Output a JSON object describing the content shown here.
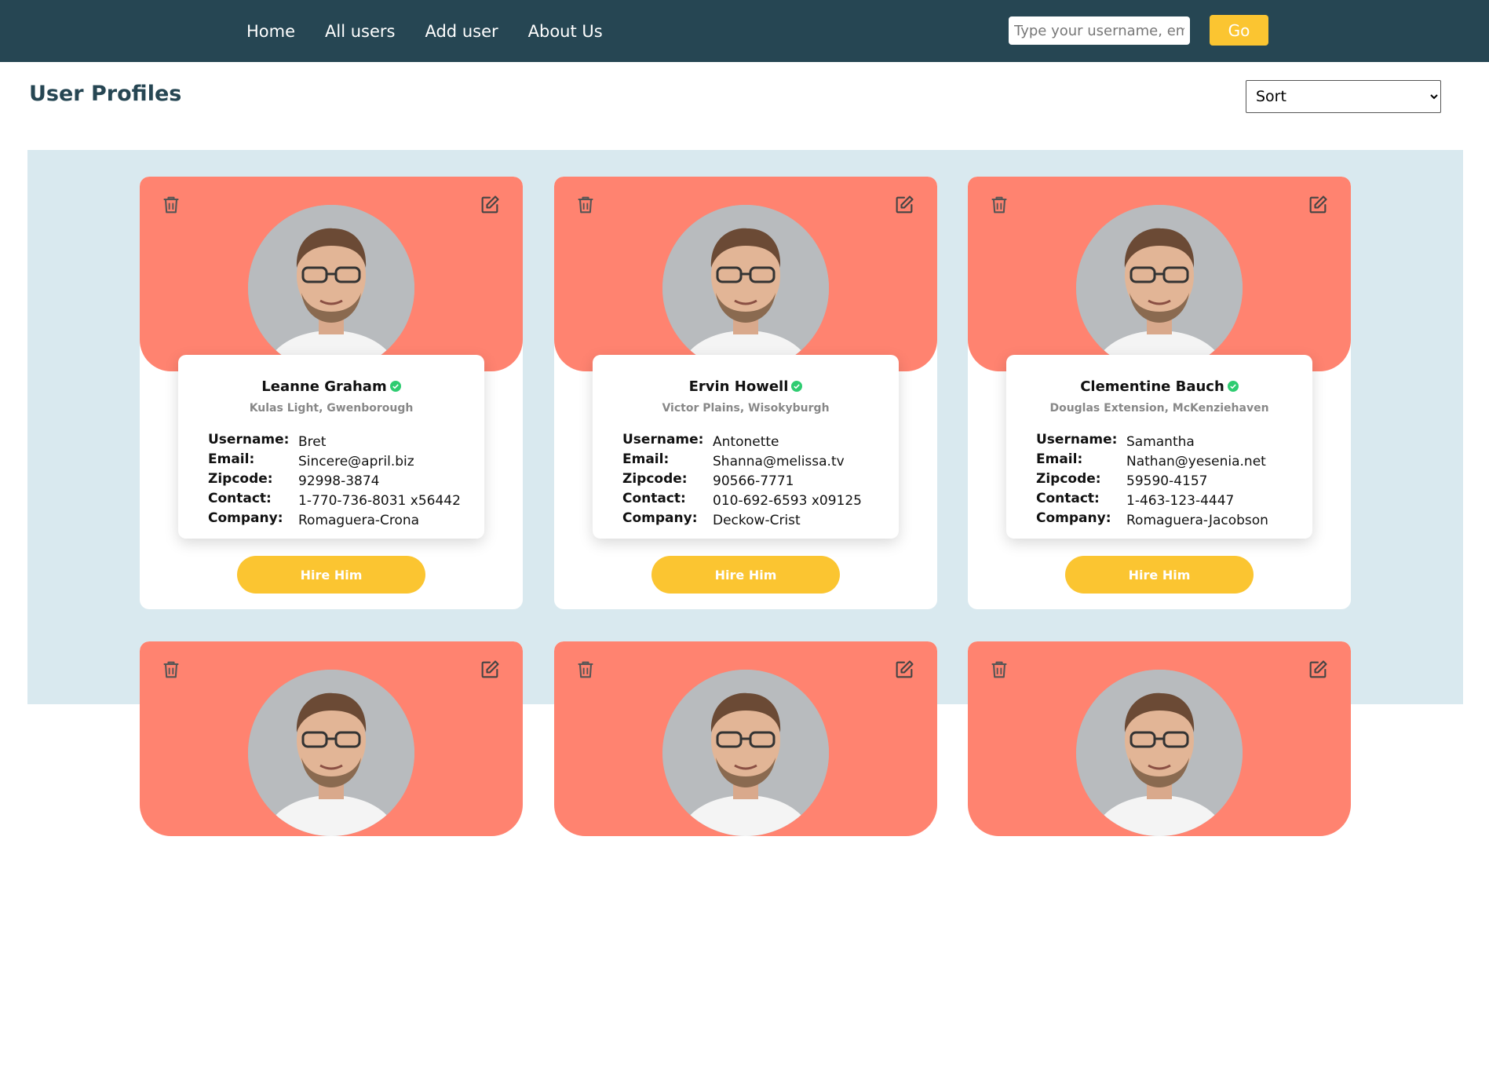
{
  "nav": {
    "links": [
      "Home",
      "All users",
      "Add user",
      "About Us"
    ],
    "search_placeholder": "Type your username, email",
    "go_label": "Go"
  },
  "page": {
    "title": "User Profiles",
    "sort_label": "Sort"
  },
  "labels": {
    "username": "Username:",
    "email": "Email:",
    "zipcode": "Zipcode:",
    "contact": "Contact:",
    "company": "Company:",
    "hire": "Hire Him"
  },
  "colors": {
    "navbar": "#264653",
    "card_header": "#ff8370",
    "accent": "#fbc531",
    "verified": "#2ecc71",
    "area_bg": "#d9e9ef"
  },
  "icons": {
    "delete": "trash-icon",
    "edit": "edit-icon",
    "verified": "verified-badge-icon"
  },
  "users": [
    {
      "name": "Leanne Graham",
      "address": "Kulas Light, Gwenborough",
      "username": "Bret",
      "email": "Sincere@april.biz",
      "zipcode": "92998-3874",
      "contact": "1-770-736-8031 x56442",
      "company": "Romaguera-Crona"
    },
    {
      "name": "Ervin Howell",
      "address": "Victor Plains, Wisokyburgh",
      "username": "Antonette",
      "email": "Shanna@melissa.tv",
      "zipcode": "90566-7771",
      "contact": "010-692-6593 x09125",
      "company": "Deckow-Crist"
    },
    {
      "name": "Clementine Bauch",
      "address": "Douglas Extension, McKenziehaven",
      "username": "Samantha",
      "email": "Nathan@yesenia.net",
      "zipcode": "59590-4157",
      "contact": "1-463-123-4447",
      "company": "Romaguera-Jacobson"
    }
  ]
}
